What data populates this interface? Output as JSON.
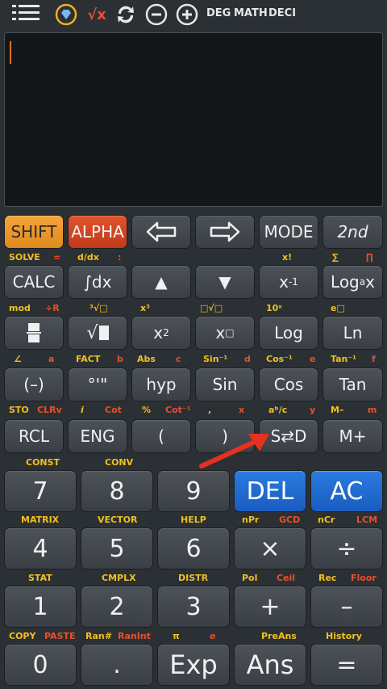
{
  "topbar": {
    "deg": "DEG",
    "math": "MATH",
    "deci": "DECI",
    "sqrt_label": "√x"
  },
  "keys": {
    "shift": "SHIFT",
    "alpha": "ALPHA",
    "mode": "MODE",
    "second": "2nd",
    "calc": "CALC",
    "integral": "∫dx",
    "up": "▲",
    "down": "▼",
    "inverse_base": "x",
    "inverse_exp": "-1",
    "log_base": "Log",
    "log_sub": "a",
    "log_x": "x",
    "sqrt": "√",
    "square_base": "x",
    "square_exp": "2",
    "power_base": "x",
    "power_exp": "□",
    "log": "Log",
    "ln": "Ln",
    "neg": "(–)",
    "degmin": "°'\"",
    "hyp": "hyp",
    "sin": "Sin",
    "cos": "Cos",
    "tan": "Tan",
    "rcl": "RCL",
    "eng": "ENG",
    "lparen": "(",
    "rparen": ")",
    "sd": "S⇄D",
    "mplus": "M+",
    "n7": "7",
    "n8": "8",
    "n9": "9",
    "del": "DEL",
    "ac": "AC",
    "n4": "4",
    "n5": "5",
    "n6": "6",
    "mul": "×",
    "div": "÷",
    "n1": "1",
    "n2": "2",
    "n3": "3",
    "plus": "+",
    "minus": "–",
    "n0": "0",
    "dot": ".",
    "exp": "Exp",
    "ans": "Ans",
    "eq": "="
  },
  "labels": {
    "solve": "SOLVE",
    "eq": "=",
    "ddx": "d/dx",
    "colon": ":",
    "fact_x": "x!",
    "sigma": "∑",
    "pi_prod": "∏",
    "mod": "mod",
    "divr": "÷R",
    "cbrt": "³√□",
    "cube": "x³",
    "xroot": "□√□",
    "tenx": "10ˣ",
    "ex": "e□",
    "angle": "∠",
    "a": "a",
    "fact": "FACT",
    "b": "b",
    "abs": "Abs",
    "c": "c",
    "asin": "Sin⁻¹",
    "d": "d",
    "acos": "Cos⁻¹",
    "e": "e",
    "atan": "Tan⁻¹",
    "f": "f",
    "sto": "STO",
    "clrv": "CLRv",
    "i": "i",
    "cot": "Cot",
    "pct": "%",
    "acot": "Cot⁻¹",
    "comma": ",",
    "x": "x",
    "abc": "aᵇ/c",
    "y": "y",
    "mminus": "M–",
    "m": "m",
    "const": "CONST",
    "conv": "CONV",
    "matrix": "MATRIX",
    "vector": "VECTOR",
    "help": "HELP",
    "npr": "nPr",
    "gcd": "GCD",
    "ncr": "nCr",
    "lcm": "LCM",
    "stat": "STAT",
    "cmplx": "CMPLX",
    "distr": "DISTR",
    "pol": "Pol",
    "ceil": "Ceil",
    "rec": "Rec",
    "floor": "Floor",
    "copy": "COPY",
    "paste": "PASTE",
    "ran": "Ran#",
    "ranint": "RanInt",
    "pi": "π",
    "e_const": "e",
    "preans": "PreAns",
    "history": "History"
  },
  "colors": {
    "shift": "#f0a030",
    "alpha": "#d84828",
    "blue": "#2a6ed0",
    "label_yellow": "#f0c020",
    "label_red": "#e8502a",
    "arrow": "#e83020"
  }
}
